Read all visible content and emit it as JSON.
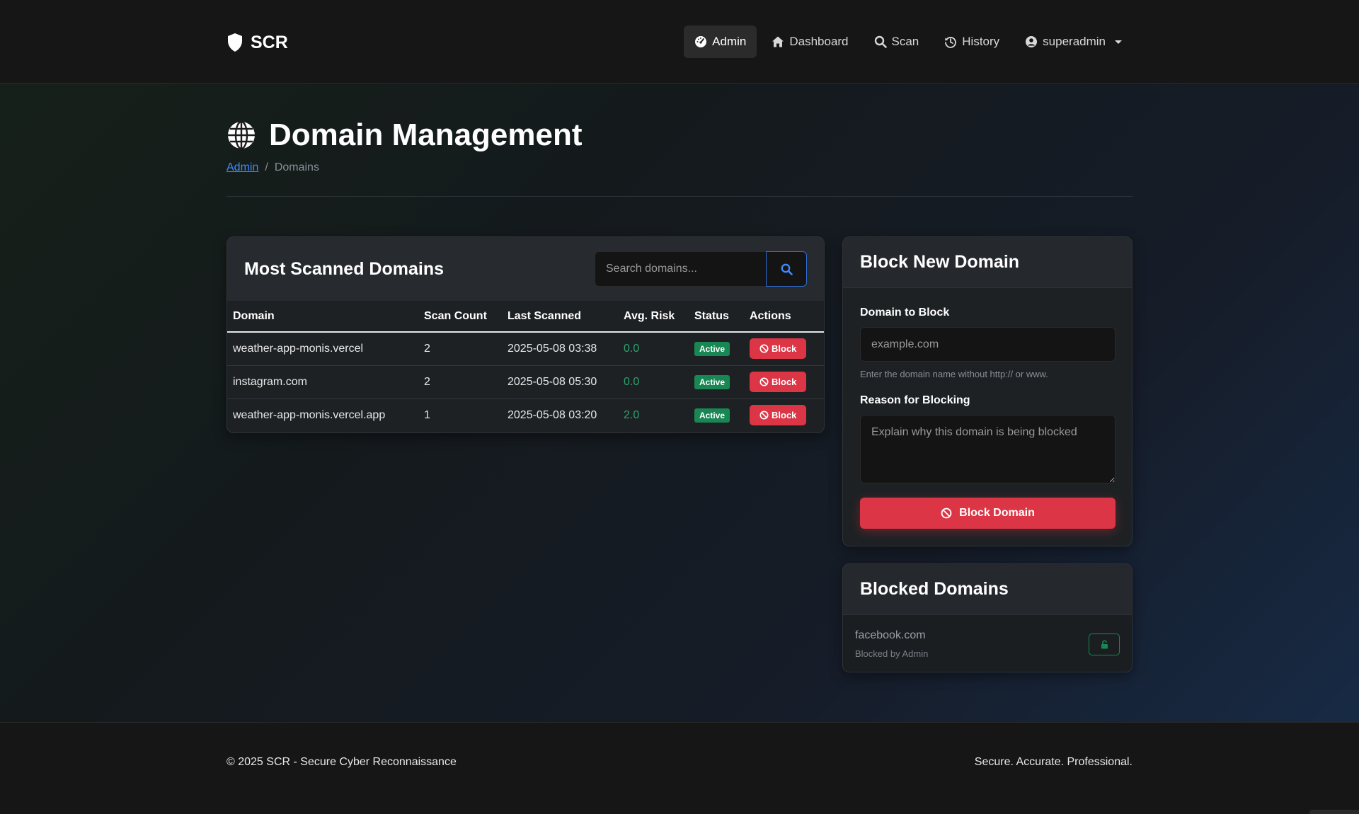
{
  "navbar": {
    "brand": "SCR",
    "items": [
      {
        "label": "Admin",
        "icon": "tachometer-icon",
        "active": true
      },
      {
        "label": "Dashboard",
        "icon": "home-icon"
      },
      {
        "label": "Scan",
        "icon": "search-icon"
      },
      {
        "label": "History",
        "icon": "history-icon"
      },
      {
        "label": "superadmin",
        "icon": "user-circle-icon"
      }
    ]
  },
  "page": {
    "title": "Domain Management",
    "breadcrumb": {
      "root": "Admin",
      "separator": "/",
      "current": "Domains"
    }
  },
  "scanned": {
    "title": "Most Scanned Domains",
    "search_placeholder": "Search domains...",
    "columns": [
      "Domain",
      "Scan Count",
      "Last Scanned",
      "Avg. Risk",
      "Status",
      "Actions"
    ],
    "rows": [
      {
        "domain": "weather-app-monis.vercel",
        "count": "2",
        "last": "2025-05-08 03:38",
        "risk": "0.0",
        "status": "Active",
        "action": "Block"
      },
      {
        "domain": "instagram.com",
        "count": "2",
        "last": "2025-05-08 05:30",
        "risk": "0.0",
        "status": "Active",
        "action": "Block"
      },
      {
        "domain": "weather-app-monis.vercel.app",
        "count": "1",
        "last": "2025-05-08 03:20",
        "risk": "2.0",
        "status": "Active",
        "action": "Block"
      }
    ]
  },
  "block_form": {
    "title": "Block New Domain",
    "domain_label": "Domain to Block",
    "domain_placeholder": "example.com",
    "domain_hint": "Enter the domain name without http:// or www.",
    "reason_label": "Reason for Blocking",
    "reason_placeholder": "Explain why this domain is being blocked",
    "submit_label": "Block Domain"
  },
  "blocked": {
    "title": "Blocked Domains",
    "items": [
      {
        "domain": "facebook.com",
        "by": "Blocked by Admin"
      }
    ]
  },
  "footer": {
    "left": "© 2025 SCR - Secure Cyber Reconnaissance",
    "right": "Secure. Accurate. Professional."
  },
  "colors": {
    "accent_blue": "#3d8bfd",
    "danger": "#dc3545",
    "success": "#198754"
  }
}
